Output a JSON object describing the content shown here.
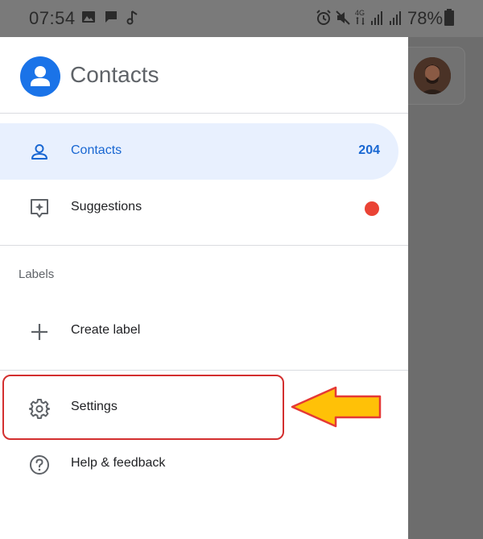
{
  "status_bar": {
    "time": "07:54",
    "battery_text": "78%",
    "icons": [
      "image-icon",
      "message-icon",
      "music-note-icon",
      "alarm-icon",
      "mute-icon",
      "4g-icon",
      "signal-icon",
      "signal-icon",
      "battery-icon"
    ]
  },
  "drawer": {
    "title": "Contacts",
    "items": [
      {
        "label": "Contacts",
        "count": "204",
        "icon": "person-icon",
        "active": true
      },
      {
        "label": "Suggestions",
        "icon": "suggestions-icon",
        "badge": "red-dot"
      }
    ],
    "labels_heading": "Labels",
    "create_label": "Create label",
    "settings": "Settings",
    "help": "Help & feedback"
  },
  "colors": {
    "accent": "#1a73e8",
    "active_bg": "#e8f0fe",
    "badge_red": "#ea4335",
    "annotation_red": "#d32f2f",
    "arrow_yellow": "#ffc107"
  }
}
